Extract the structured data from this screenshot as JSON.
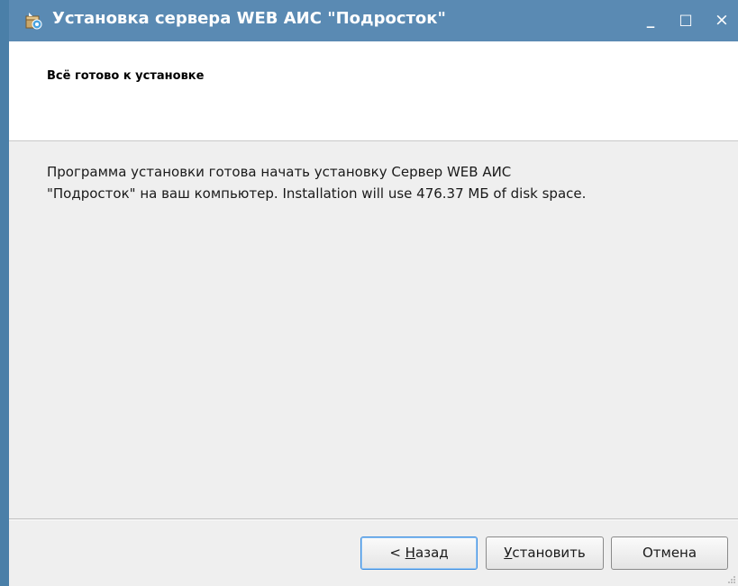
{
  "window": {
    "title": "Установка сервера WEB АИС \"Подросток\"",
    "minimize_label": "_",
    "maximize_label": "□",
    "close_label": "×"
  },
  "header": {
    "title": "Всё готово к установке"
  },
  "content": {
    "message_line1": "Программа установки готова начать установку Сервер WEB АИС",
    "message_line2": "\"Подросток\" на ваш компьютер. Installation will use 476.37 МБ of disk space."
  },
  "buttons": {
    "back_prefix": "< ",
    "back_mnemonic": "Н",
    "back_rest": "азад",
    "install_mnemonic": "У",
    "install_rest": "становить",
    "cancel_label": "Отмена"
  },
  "colors": {
    "titlebar": "#5a8ab3",
    "left_edge": "#4a7fa8",
    "focus_border": "#3d8ee0"
  },
  "icons": {
    "app": "installer-package-icon",
    "resize": "resize-grip-icon"
  }
}
